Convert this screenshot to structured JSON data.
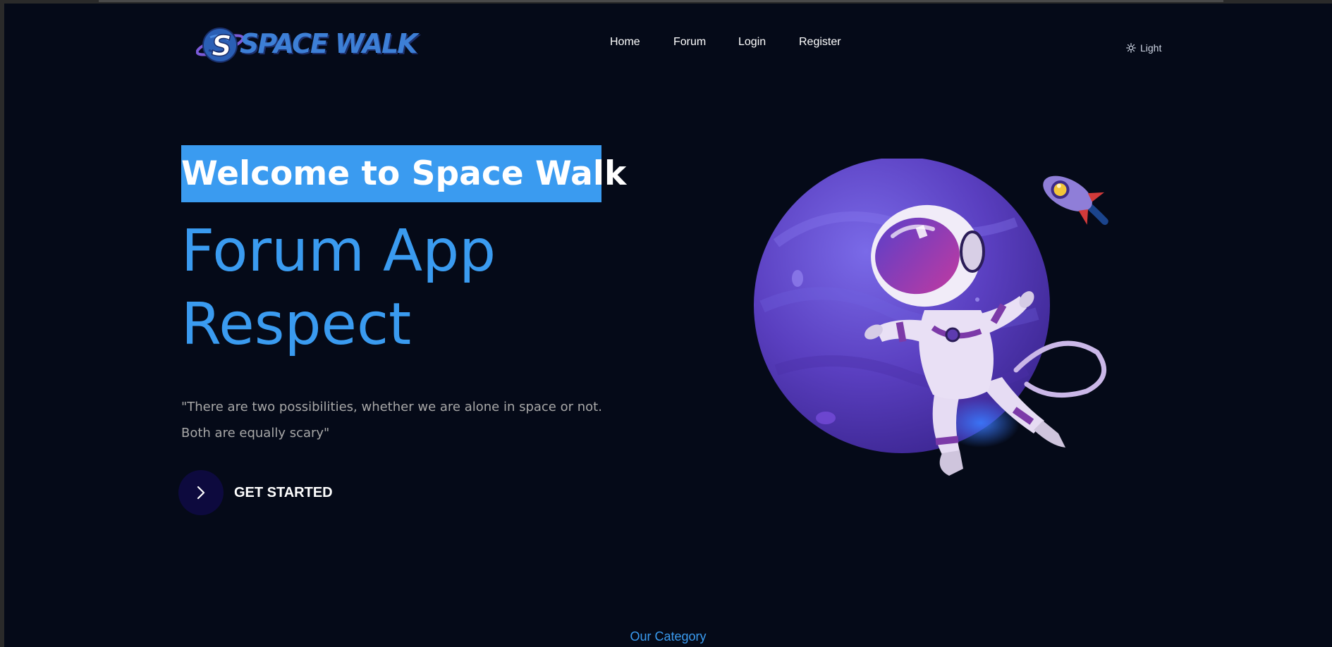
{
  "header": {
    "logo_text": "SPACE WALK",
    "nav": [
      "Home",
      "Forum",
      "Login",
      "Register"
    ],
    "theme_toggle": {
      "icon": "sun-icon",
      "label": "Light"
    }
  },
  "hero": {
    "welcome": "Welcome to Space Walk",
    "headline_line1": "Forum App",
    "headline_line2": "Respect",
    "quote_line1": "\"There are two possibilities, whether we are alone in space or not.",
    "quote_line2": "Both are equally scary\"",
    "cta_label": "GET STARTED",
    "cta_icon": "chevron-right-icon"
  },
  "category_heading": "Our Category",
  "colors": {
    "background": "#050a18",
    "accent": "#3a9bf0",
    "quote_text": "#a7a7a7",
    "cta_circle": "#0d0a3e"
  }
}
